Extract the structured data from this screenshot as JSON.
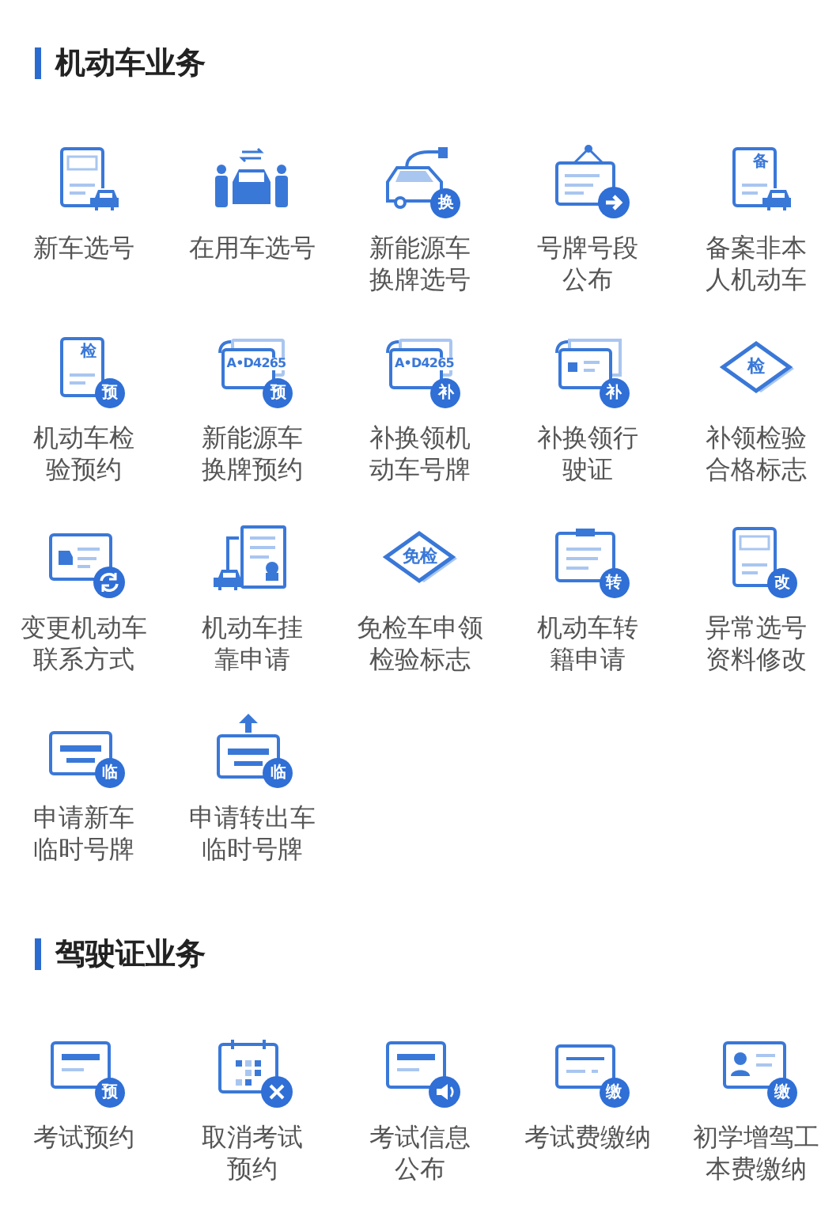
{
  "sections": [
    {
      "title": "机动车业务",
      "items": [
        {
          "lines": [
            "新车选号"
          ],
          "kind": "doc-car"
        },
        {
          "lines": [
            "在用车选号"
          ],
          "kind": "people-car"
        },
        {
          "lines": [
            "新能源车",
            "换牌选号"
          ],
          "kind": "ev-car",
          "badge": "换"
        },
        {
          "lines": [
            "号牌号段",
            "公布"
          ],
          "kind": "signboard-arrow"
        },
        {
          "lines": [
            "备案非本",
            "人机动车"
          ],
          "kind": "doc-car",
          "tag": "备"
        },
        {
          "lines": [
            "机动车检",
            "验预约"
          ],
          "kind": "doc",
          "tag": "检",
          "badge": "预"
        },
        {
          "lines": [
            "新能源车",
            "换牌预约"
          ],
          "kind": "plate-stack",
          "tag": "A•D4265",
          "badge": "预"
        },
        {
          "lines": [
            "补换领机",
            "动车号牌"
          ],
          "kind": "plate-stack",
          "tag": "A•D4265",
          "badge": "补"
        },
        {
          "lines": [
            "补换领行",
            "驶证"
          ],
          "kind": "card-stack",
          "badge": "补"
        },
        {
          "lines": [
            "补领检验",
            "合格标志"
          ],
          "kind": "diamond",
          "tag": "检"
        },
        {
          "lines": [
            "变更机动车",
            "联系方式"
          ],
          "kind": "card-refresh"
        },
        {
          "lines": [
            "机动车挂",
            "靠申请"
          ],
          "kind": "doc-crane"
        },
        {
          "lines": [
            "免检车申领",
            "检验标志"
          ],
          "kind": "diamond",
          "tag": "免检"
        },
        {
          "lines": [
            "机动车转",
            "籍申请"
          ],
          "kind": "clipboard",
          "badge": "转"
        },
        {
          "lines": [
            "异常选号",
            "资料修改"
          ],
          "kind": "doc",
          "badge": "改"
        },
        {
          "lines": [
            "申请新车",
            "临时号牌"
          ],
          "kind": "temp-plate",
          "badge": "临"
        },
        {
          "lines": [
            "申请转出车",
            "临时号牌"
          ],
          "kind": "temp-plate-up",
          "badge": "临"
        }
      ]
    },
    {
      "title": "驾驶证业务",
      "items": [
        {
          "lines": [
            "考试预约"
          ],
          "kind": "card-bar",
          "badge": "预"
        },
        {
          "lines": [
            "取消考试",
            "预约"
          ],
          "kind": "calendar-close"
        },
        {
          "lines": [
            "考试信息",
            "公布"
          ],
          "kind": "card-bar-speaker"
        },
        {
          "lines": [
            "考试费缴纳"
          ],
          "kind": "card-lines",
          "badge": "缴"
        },
        {
          "lines": [
            "初学增驾工",
            "本费缴纳"
          ],
          "kind": "id-card",
          "badge": "缴"
        }
      ]
    }
  ]
}
